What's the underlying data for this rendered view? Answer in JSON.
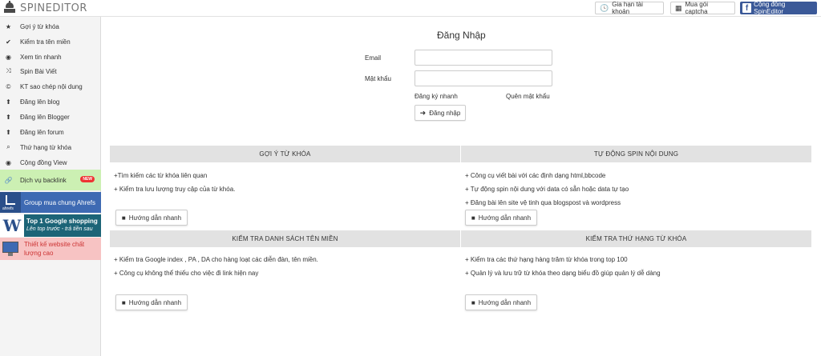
{
  "header": {
    "brand": "SPINEDITOR",
    "buttons": [
      {
        "label": "Gia hạn tài khoản",
        "icon": "clock-icon"
      },
      {
        "label": "Mua gói captcha",
        "icon": "qrcode-icon"
      },
      {
        "label": "Cộng đồng SpinEditor",
        "icon": "facebook-icon"
      }
    ]
  },
  "sidebar": {
    "items": [
      {
        "label": "Gợi ý từ khóa",
        "icon": "star-icon"
      },
      {
        "label": "Kiểm tra tên miền",
        "icon": "check-icon"
      },
      {
        "label": "Xem tin nhanh",
        "icon": "eye-icon"
      },
      {
        "label": "Spin Bài Viết",
        "icon": "shuffle-icon"
      },
      {
        "label": "KT sao chép nội dung",
        "icon": "copyright-icon"
      },
      {
        "label": "Đăng lên blog",
        "icon": "upload-icon"
      },
      {
        "label": "Đăng lên Blogger",
        "icon": "upload-icon"
      },
      {
        "label": "Đăng lên forum",
        "icon": "upload-icon"
      },
      {
        "label": "Thứ hạng từ khóa",
        "icon": "search-icon"
      },
      {
        "label": "Cộng đồng View",
        "icon": "eye-icon"
      }
    ],
    "backlink": {
      "label": "Dịch vụ backlink",
      "badge": "NEW",
      "icon": "link-icon"
    },
    "promos": {
      "ahrefs": "Group mua chung Ahrefs",
      "ahrefs_logo": "ahrefs",
      "shop_line1": "Top 1 Google shopping",
      "shop_line2": "Lên top trước - trả tiền sau",
      "web_line1": "Thiết kế website chất",
      "web_line2": "lượng cao"
    }
  },
  "login": {
    "title": "Đăng Nhập",
    "email_label": "Email",
    "email_value": "",
    "password_label": "Mật khẩu",
    "password_value": "",
    "register_link": "Đăng ký nhanh",
    "forgot_link": "Quên mật khẩu",
    "submit_label": "Đăng nhập"
  },
  "panels": [
    {
      "title": "GỢI Ý TỪ KHÓA",
      "bullets": [
        "+Tìm kiếm các từ khóa liên quan",
        "+ Kiểm tra lưu lượng truy cập của từ khóa."
      ],
      "button": "Hướng dẫn nhanh"
    },
    {
      "title": "TỰ ĐỘNG SPIN NỘI DUNG",
      "bullets": [
        "+ Công cụ viết bài với các định dạng html,bbcode",
        "+ Tự động spin nội dung với data có sẵn hoặc data tự tạo",
        "+ Đăng bài lên site vệ tinh qua blogspost và wordpress"
      ],
      "button": "Hướng dẫn nhanh"
    },
    {
      "title": "KIỂM TRA DANH SÁCH TÊN MIỀN",
      "bullets": [
        "+ Kiểm tra Google index , PA , DA cho hàng loạt các diễn đàn, tên miền.",
        "+ Công cụ không thể thiếu cho việc đi link hiện nay"
      ],
      "button": "Hướng dẫn nhanh"
    },
    {
      "title": "KIỂM TRA THỨ HẠNG TỪ KHÓA",
      "bullets": [
        "+ Kiểm tra các thứ hạng hàng trăm từ khóa trong top 100",
        "+ Quản lý và lưu trữ từ khóa theo dạng biểu đồ giúp quản lý dễ dàng"
      ],
      "button": "Hướng dẫn nhanh"
    }
  ]
}
